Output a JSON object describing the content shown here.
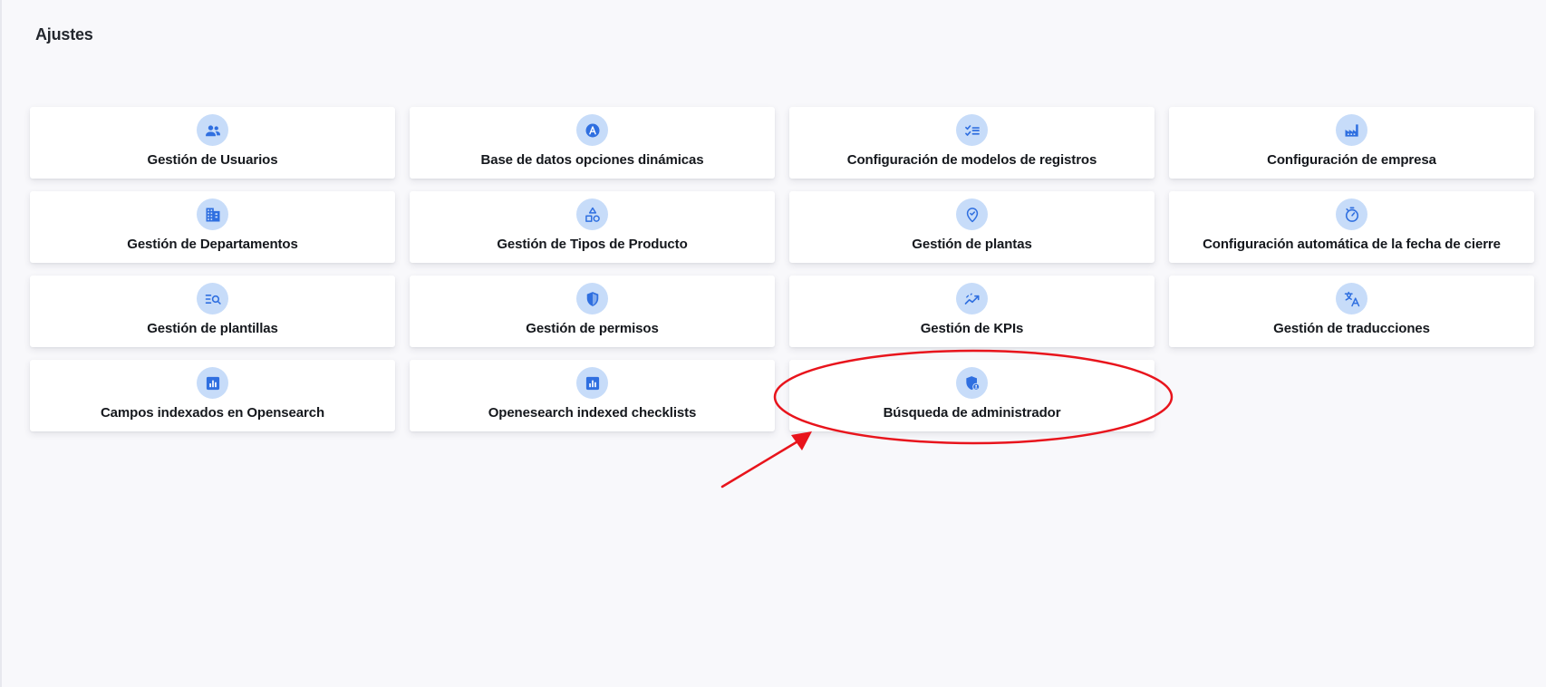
{
  "page": {
    "title": "Ajustes"
  },
  "cards": [
    {
      "label": "Gestión de Usuarios",
      "icon": "users-icon"
    },
    {
      "label": "Base de datos opciones dinámicas",
      "icon": "letter-a-icon"
    },
    {
      "label": "Configuración de modelos de registros",
      "icon": "checklist-icon"
    },
    {
      "label": "Configuración de empresa",
      "icon": "factory-icon"
    },
    {
      "label": "Gestión de Departamentos",
      "icon": "building-icon"
    },
    {
      "label": "Gestión de Tipos de Producto",
      "icon": "shapes-icon"
    },
    {
      "label": "Gestión de plantas",
      "icon": "location-check-icon"
    },
    {
      "label": "Configuración automática de la fecha de cierre",
      "icon": "timer-icon"
    },
    {
      "label": "Gestión de plantillas",
      "icon": "list-search-icon"
    },
    {
      "label": "Gestión de permisos",
      "icon": "shield-icon"
    },
    {
      "label": "Gestión de KPIs",
      "icon": "trending-icon"
    },
    {
      "label": "Gestión de traducciones",
      "icon": "translate-icon"
    },
    {
      "label": "Campos indexados en Opensearch",
      "icon": "bar-chart-icon"
    },
    {
      "label": "Openesearch indexed checklists",
      "icon": "bar-chart-icon"
    },
    {
      "label": "Búsqueda de administrador",
      "icon": "admin-shield-icon"
    }
  ],
  "colors": {
    "background": "#f8f8fb",
    "card": "#ffffff",
    "icon_circle": "#c7dcf9",
    "icon": "#2f6fe0",
    "annotation": "#e8141c"
  }
}
